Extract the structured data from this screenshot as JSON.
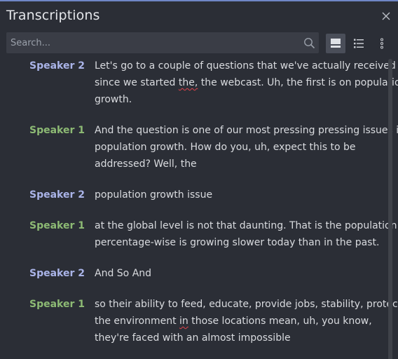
{
  "panel": {
    "title": "Transcriptions"
  },
  "search": {
    "placeholder": "Search..."
  },
  "toolbar": {
    "icons": [
      "close-icon",
      "search-icon",
      "single-view-icon",
      "list-view-icon",
      "more-vertical-icon"
    ]
  },
  "colors": {
    "speaker_1": "#8dba74",
    "speaker_2": "#aab4e8",
    "accent": "#6f86c6",
    "background": "#2b2e36"
  },
  "transcript": [
    {
      "speaker": "Speaker 2",
      "lines": [
        [
          "Let's go to a couple of questions that we've actually received"
        ],
        [
          "since we started ",
          "the,",
          " the webcast. Uh, the first is on population"
        ],
        [
          "growth."
        ]
      ]
    },
    {
      "speaker": "Speaker 1",
      "lines": [
        [
          "And the question is one of our most pressing pressing issues is"
        ],
        [
          "population growth. How do you, uh, expect this to be"
        ],
        [
          "addressed? Well, the"
        ]
      ]
    },
    {
      "speaker": "Speaker 2",
      "lines": [
        [
          "population growth issue"
        ]
      ]
    },
    {
      "speaker": "Speaker 1",
      "lines": [
        [
          "at the global level is not that daunting. That is the population"
        ],
        [
          "percentage-wise is growing slower today than in the past."
        ]
      ]
    },
    {
      "speaker": "Speaker 2",
      "lines": [
        [
          "And So And"
        ]
      ]
    },
    {
      "speaker": "Speaker 1",
      "lines": [
        [
          "so their ability to feed, educate, provide jobs, stability, protect"
        ],
        [
          "the environment ",
          "in",
          " those locations mean, uh, you know,"
        ],
        [
          "they're faced with an almost impossible"
        ]
      ]
    }
  ]
}
